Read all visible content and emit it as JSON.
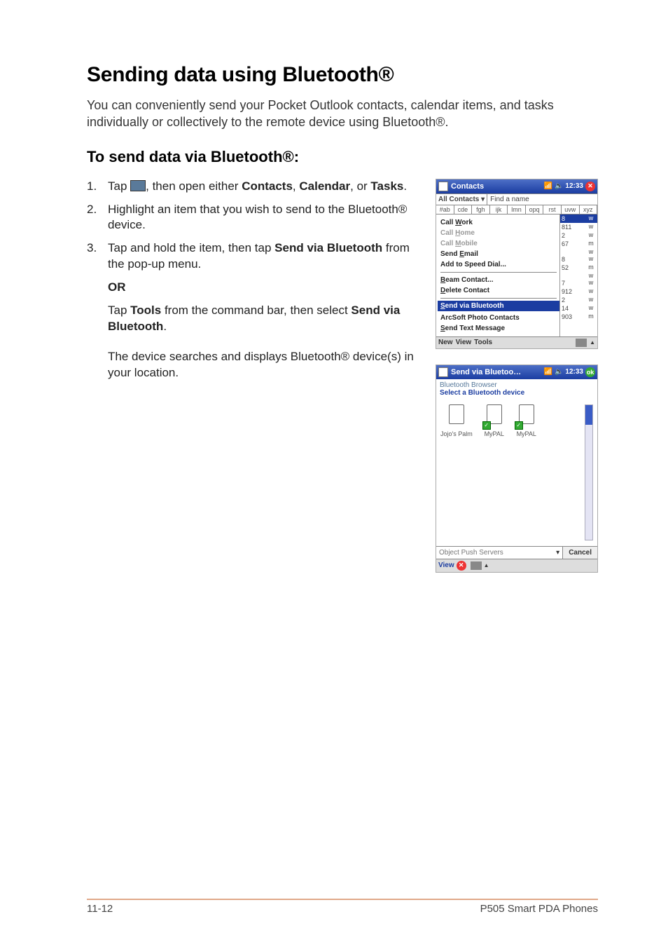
{
  "page_title": "Sending data using Bluetooth®",
  "intro": "You can conveniently send your Pocket Outlook contacts, calendar items, and tasks individually or collectively to the remote device using Bluetooth®.",
  "subsection": "To send data via Bluetooth®:",
  "steps": {
    "s1a": "Tap ",
    "s1b": ", then open either ",
    "s1c": "Contacts",
    "s1d": "Calendar",
    "s1e": ", or ",
    "s1f": "Tasks",
    "s1g": ".",
    "s2": "Highlight an item that you wish to send to the Bluetooth® device.",
    "s3a": "Tap and hold the item, then tap ",
    "s3b": "Send via Bluetooth",
    "s3c": " from the pop-up menu.",
    "or": "OR",
    "or_a": "Tap ",
    "or_b": "Tools",
    "or_c": " from the command bar, then select ",
    "or_d": "Send via Bluetooth",
    "or_e": ".",
    "info": "The device searches and displays Bluetooth® device(s) in your location."
  },
  "screenshot1": {
    "title": "Contacts",
    "time": "12:33",
    "filter_left": "All Contacts ▾",
    "find_label": "Find a name",
    "alpha": [
      "#ab",
      "cde",
      "fgh",
      "ijk",
      "lmn",
      "opq",
      "rst",
      "uvw",
      "xyz"
    ],
    "ctx_menu": [
      {
        "label": "Call Work",
        "dim": false,
        "ul": "W"
      },
      {
        "label": "Call Home",
        "dim": true,
        "ul": "H"
      },
      {
        "label": "Call Mobile",
        "dim": true,
        "ul": "M"
      },
      {
        "label": "Send Email",
        "dim": false,
        "ul": "E"
      },
      {
        "label": "Add to Speed Dial...",
        "dim": false,
        "ul": ""
      },
      {
        "sep": true
      },
      {
        "label": "Beam Contact...",
        "dim": false,
        "ul": "B"
      },
      {
        "label": "Delete Contact",
        "dim": false,
        "ul": "D"
      },
      {
        "sep": true
      },
      {
        "label": "Send via Bluetooth",
        "hl": true,
        "ul": "S"
      },
      {
        "label": "ArcSoft Photo Contacts",
        "dim": false
      },
      {
        "label": "Send Text Message",
        "dim": false,
        "ul": "S"
      }
    ],
    "right_rows": [
      {
        "a": "8",
        "b": "w",
        "hl": true
      },
      {
        "a": "811",
        "b": "w"
      },
      {
        "a": "2",
        "b": "w"
      },
      {
        "a": "67",
        "b": "m"
      },
      {
        "a": "",
        "b": "w"
      },
      {
        "a": "8",
        "b": "w"
      },
      {
        "a": "52",
        "b": "m"
      },
      {
        "a": "",
        "b": "w"
      },
      {
        "a": "7",
        "b": "w"
      },
      {
        "a": "912",
        "b": "w"
      },
      {
        "a": "2",
        "b": "w"
      },
      {
        "a": "14",
        "b": "w"
      },
      {
        "a": "903",
        "b": "m"
      }
    ],
    "cmd": [
      "New",
      "View",
      "Tools"
    ]
  },
  "screenshot2": {
    "title": "Send via Bluetoo…",
    "time": "12:33",
    "heading": "Bluetooth Browser",
    "subheading": "Select a Bluetooth device",
    "devices": [
      {
        "name": "Jojo's Palm",
        "tick": false
      },
      {
        "name": "MyPAL",
        "tick": true
      },
      {
        "name": "MyPAL",
        "tick": true
      }
    ],
    "combo": "Object Push Servers",
    "cancel": "Cancel",
    "cmd": "View"
  },
  "footer": {
    "left": "11-12",
    "right": "P505 Smart PDA Phones"
  }
}
